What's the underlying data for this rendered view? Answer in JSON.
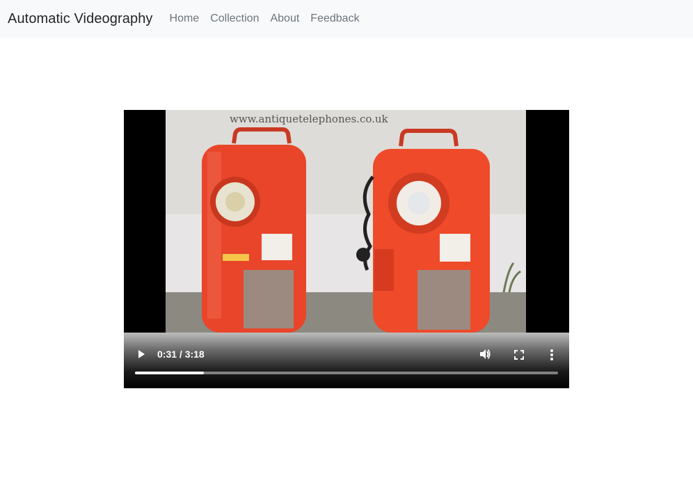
{
  "navbar": {
    "brand": "Automatic Videography",
    "links": [
      "Home",
      "Collection",
      "About",
      "Feedback"
    ]
  },
  "video": {
    "watermark": "www.antiquetelephones.co.uk",
    "current_time": "0:31",
    "duration": "3:18",
    "time_display": "0:31 / 3:18",
    "progress_fraction": 0.1633,
    "buttons": [
      "play-icon",
      "volume-icon",
      "fullscreen-icon",
      "more-options-icon"
    ]
  },
  "colors": {
    "navbar_bg": "#f8f9fa",
    "phone_red": "#e8452a",
    "video_bg": "#000000"
  }
}
